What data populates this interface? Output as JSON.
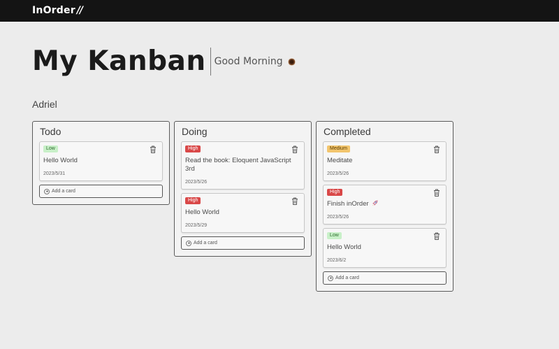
{
  "app": {
    "logo": "InOrder",
    "logo_mark": "//",
    "title": "My Kanban",
    "greeting": "Good Morning",
    "user": "Adriel"
  },
  "columns": [
    {
      "title": "Todo",
      "add_label": "Add a card",
      "cards": [
        {
          "priority": "Low",
          "title": "Hello World",
          "date": "2023/5/31"
        }
      ]
    },
    {
      "title": "Doing",
      "add_label": "Add a card",
      "cards": [
        {
          "priority": "High",
          "title": "Read the book: Eloquent JavaScript 3rd",
          "date": "2023/5/26"
        },
        {
          "priority": "High",
          "title": "Hello World",
          "date": "2023/5/29"
        }
      ]
    },
    {
      "title": "Completed",
      "add_label": "Add a card",
      "cards": [
        {
          "priority": "Medium",
          "title": "Meditate",
          "date": "2023/5/26"
        },
        {
          "priority": "High",
          "title": "Finish inOrder",
          "date": "2023/5/26"
        },
        {
          "priority": "Low",
          "title": "Hello World",
          "date": "2023/6/2"
        }
      ]
    }
  ],
  "colors": {
    "topbar": "#141414",
    "background": "#ececec",
    "low": "#c8f0c8",
    "medium": "#f2c56d",
    "high": "#d94848"
  },
  "icons": [
    "coffee-icon",
    "trash-icon",
    "plus-circle-icon",
    "rocket-icon"
  ]
}
